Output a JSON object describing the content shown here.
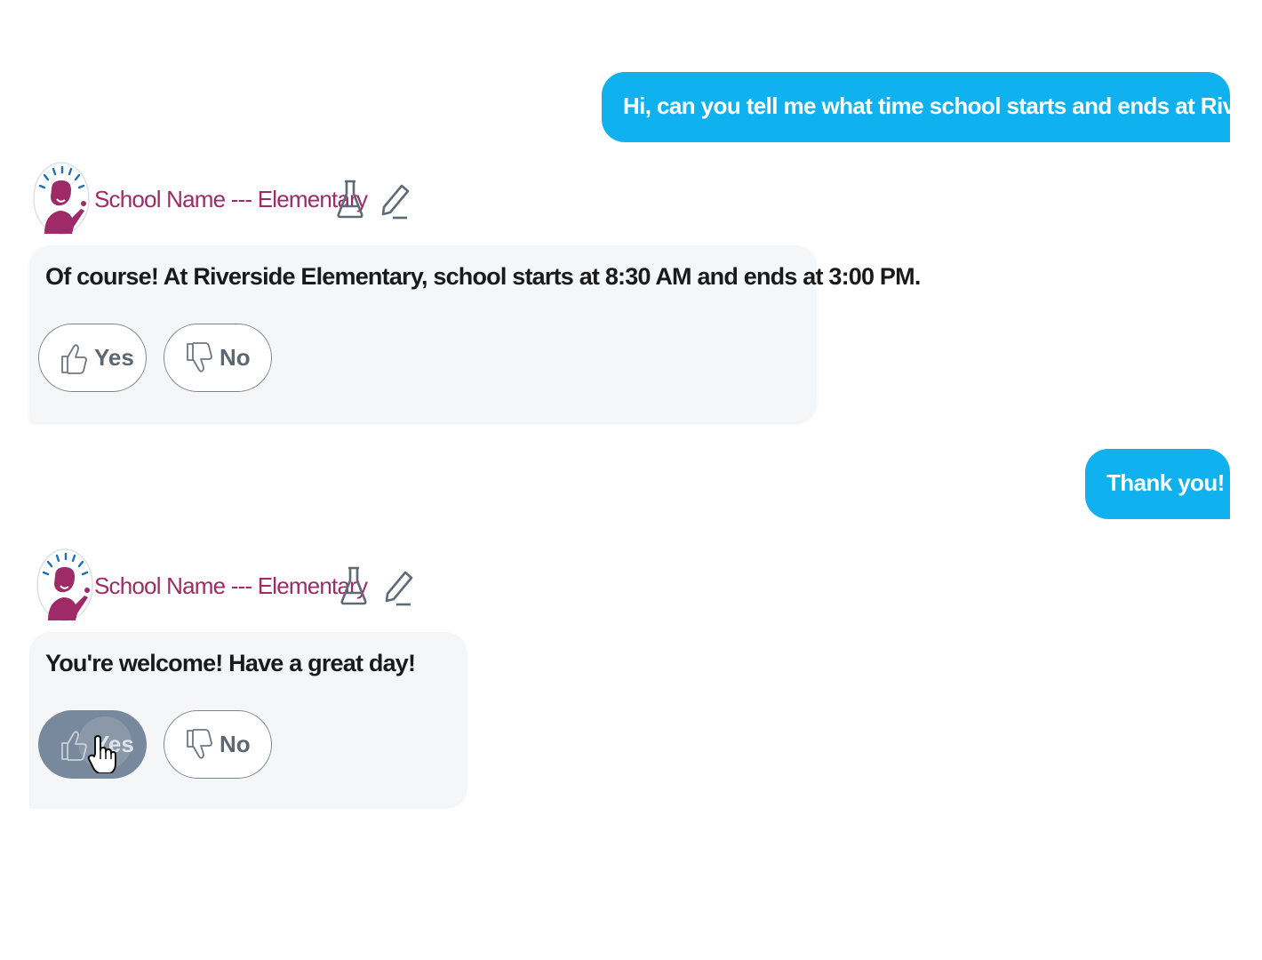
{
  "messages": {
    "user_1": "Hi, can you tell me what time school starts and ends at Riverside?",
    "bot_1": "Of course! At Riverside Elementary, school starts at 8:30 AM and ends at 3:00 PM.",
    "user_2": "Thank you!",
    "bot_2": "You're welcome! Have a great day!"
  },
  "bot": {
    "name": "School Name --- Elementary",
    "avatar_icon": "school-mascot-avatar",
    "actions": [
      "flask-icon",
      "edit-pencil-icon"
    ]
  },
  "feedback": {
    "yes_label": "Yes",
    "no_label": "No",
    "yes_icon": "thumbs-up-icon",
    "no_icon": "thumbs-down-icon"
  },
  "colors": {
    "user_bubble": "#10b1ef",
    "bot_name": "#9e2a67",
    "bot_bubble": "#f5f6f8",
    "feedback_active": "#78889d",
    "avatar_head": "#9e2a67",
    "avatar_rays": "#1e6fb6"
  }
}
